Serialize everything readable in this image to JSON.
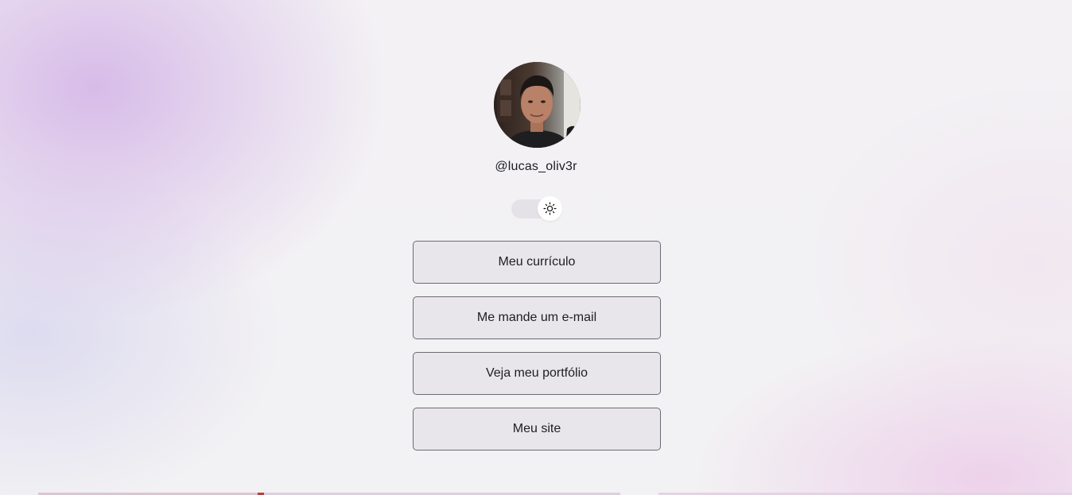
{
  "profile": {
    "handle": "@lucas_oliv3r",
    "avatar_icon": "profile-photo"
  },
  "theme": {
    "icon": "sun-icon",
    "mode": "light"
  },
  "links": [
    {
      "label": "Meu currículo"
    },
    {
      "label": "Me mande um e-mail"
    },
    {
      "label": "Veja meu portfólio"
    },
    {
      "label": "Meu site"
    }
  ],
  "colors": {
    "background_left": "#d2b2e6",
    "background_right": "#eccae8",
    "button_border": "#6d6b73",
    "text": "#1d1d22"
  }
}
